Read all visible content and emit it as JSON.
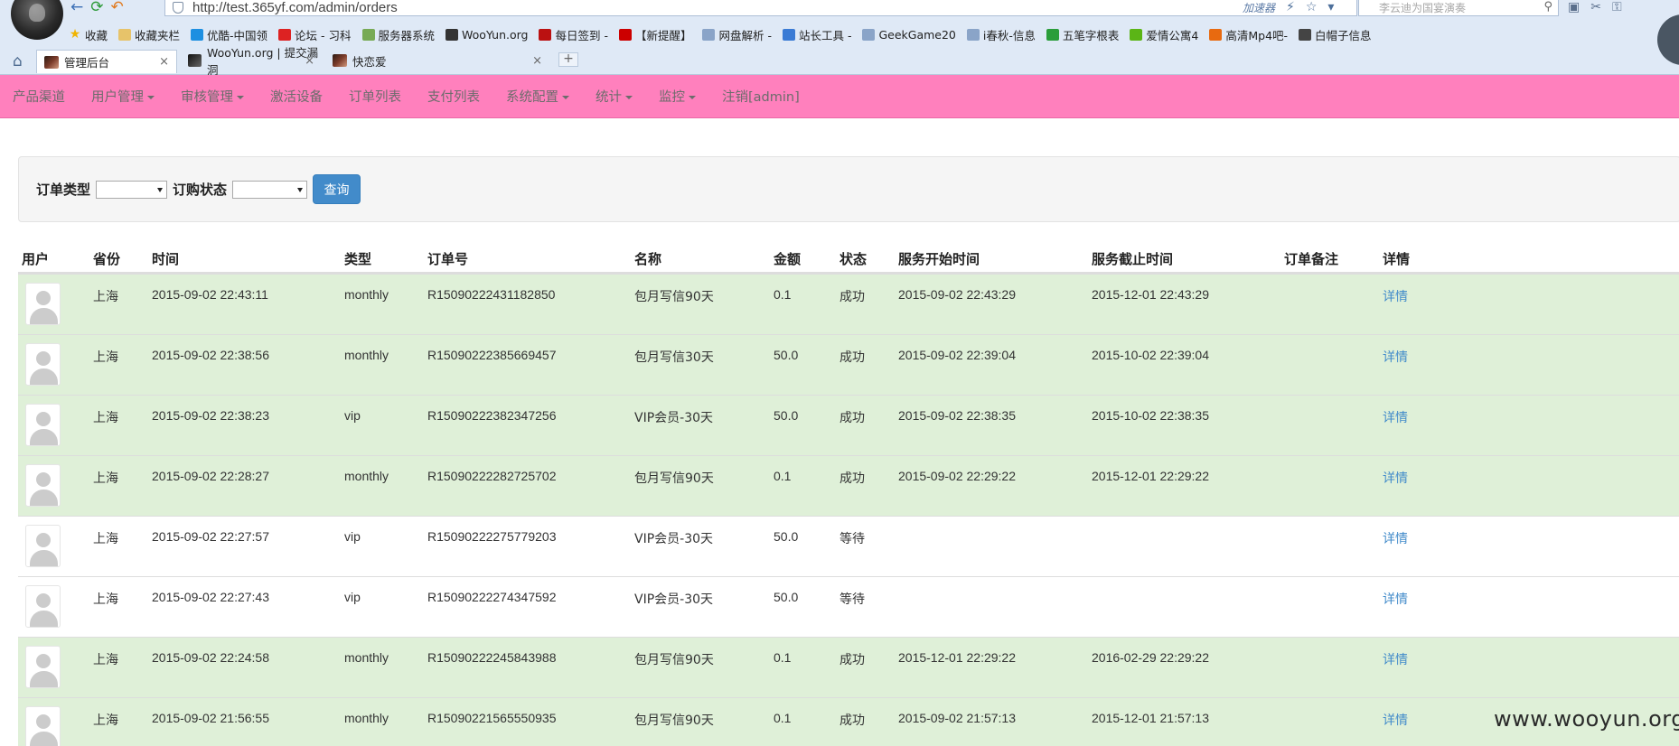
{
  "browser": {
    "url": "http://test.365yf.com/admin/orders",
    "accelerator_label": "加速器",
    "search_placeholder": "李云迪为国宴演奏",
    "bookmarks": [
      {
        "label": "收藏",
        "icon": "star-icon"
      },
      {
        "label": "收藏夹栏",
        "icon": "folder-icon"
      },
      {
        "label": "优酷-中国领",
        "icon": "youku-icon"
      },
      {
        "label": "论坛 - 习科",
        "icon": "slc-icon"
      },
      {
        "label": "服务器系统",
        "icon": "server-icon"
      },
      {
        "label": "WooYun.org",
        "icon": "wooyun-icon"
      },
      {
        "label": "每日签到 -",
        "icon": "huc-icon"
      },
      {
        "label": "【新提醒】",
        "icon": "h-icon"
      },
      {
        "label": "网盘解析 -",
        "icon": "page-icon"
      },
      {
        "label": "站长工具 -",
        "icon": "tools-icon"
      },
      {
        "label": "GeekGame20",
        "icon": "page-icon"
      },
      {
        "label": "i春秋-信息",
        "icon": "page-icon"
      },
      {
        "label": "五笔字根表",
        "icon": "leaf-icon"
      },
      {
        "label": "爱情公寓4",
        "icon": "iqiyi-icon"
      },
      {
        "label": "高清Mp4吧-",
        "icon": "play-icon"
      },
      {
        "label": "白帽子信息",
        "icon": "hat-icon"
      }
    ],
    "tabs": [
      {
        "label": "管理后台",
        "active": true
      },
      {
        "label": "WooYun.org | 提交漏洞",
        "active": false
      },
      {
        "label": "快恋爱",
        "active": false
      }
    ],
    "new_tab_symbol": "+"
  },
  "nav": {
    "items": [
      {
        "label": "产品渠道",
        "dropdown": false
      },
      {
        "label": "用户管理",
        "dropdown": true
      },
      {
        "label": "审核管理",
        "dropdown": true
      },
      {
        "label": "激活设备",
        "dropdown": false
      },
      {
        "label": "订单列表",
        "dropdown": false
      },
      {
        "label": "支付列表",
        "dropdown": false
      },
      {
        "label": "系统配置",
        "dropdown": true
      },
      {
        "label": "统计",
        "dropdown": true
      },
      {
        "label": "监控",
        "dropdown": true
      },
      {
        "label": "注销[admin]",
        "dropdown": false
      }
    ],
    "bg_color": "#ff80bd"
  },
  "filter": {
    "order_type_label": "订单类型",
    "order_type_value": "",
    "order_status_label": "订购状态",
    "order_status_value": "",
    "query_button": "查询"
  },
  "table": {
    "headers": [
      "用户",
      "省份",
      "时间",
      "类型",
      "订单号",
      "名称",
      "金额",
      "状态",
      "服务开始时间",
      "服务截止时间",
      "订单备注",
      "详情"
    ],
    "rows": [
      {
        "province": "上海",
        "time": "2015-09-02 22:43:11",
        "type": "monthly",
        "order_no": "R15090222431182850",
        "name": "包月写信90天",
        "amount": "0.1",
        "status": "成功",
        "start": "2015-09-02 22:43:29",
        "end": "2015-12-01 22:43:29",
        "note": "",
        "detail": "详情"
      },
      {
        "province": "上海",
        "time": "2015-09-02 22:38:56",
        "type": "monthly",
        "order_no": "R15090222385669457",
        "name": "包月写信30天",
        "amount": "50.0",
        "status": "成功",
        "start": "2015-09-02 22:39:04",
        "end": "2015-10-02 22:39:04",
        "note": "",
        "detail": "详情"
      },
      {
        "province": "上海",
        "time": "2015-09-02 22:38:23",
        "type": "vip",
        "order_no": "R15090222382347256",
        "name": "VIP会员-30天",
        "amount": "50.0",
        "status": "成功",
        "start": "2015-09-02 22:38:35",
        "end": "2015-10-02 22:38:35",
        "note": "",
        "detail": "详情"
      },
      {
        "province": "上海",
        "time": "2015-09-02 22:28:27",
        "type": "monthly",
        "order_no": "R15090222282725702",
        "name": "包月写信90天",
        "amount": "0.1",
        "status": "成功",
        "start": "2015-09-02 22:29:22",
        "end": "2015-12-01 22:29:22",
        "note": "",
        "detail": "详情"
      },
      {
        "province": "上海",
        "time": "2015-09-02 22:27:57",
        "type": "vip",
        "order_no": "R15090222275779203",
        "name": "VIP会员-30天",
        "amount": "50.0",
        "status": "等待",
        "start": "",
        "end": "",
        "note": "",
        "detail": "详情"
      },
      {
        "province": "上海",
        "time": "2015-09-02 22:27:43",
        "type": "vip",
        "order_no": "R15090222274347592",
        "name": "VIP会员-30天",
        "amount": "50.0",
        "status": "等待",
        "start": "",
        "end": "",
        "note": "",
        "detail": "详情"
      },
      {
        "province": "上海",
        "time": "2015-09-02 22:24:58",
        "type": "monthly",
        "order_no": "R15090222245843988",
        "name": "包月写信90天",
        "amount": "0.1",
        "status": "成功",
        "start": "2015-12-01 22:29:22",
        "end": "2016-02-29 22:29:22",
        "note": "",
        "detail": "详情"
      },
      {
        "province": "上海",
        "time": "2015-09-02 21:56:55",
        "type": "monthly",
        "order_no": "R15090221565550935",
        "name": "包月写信90天",
        "amount": "0.1",
        "status": "成功",
        "start": "2015-09-02 21:57:13",
        "end": "2015-12-01 21:57:13",
        "note": "",
        "detail": "详情"
      }
    ],
    "success_row_color": "#dff0d8"
  },
  "watermark": "www.wooyun.org"
}
